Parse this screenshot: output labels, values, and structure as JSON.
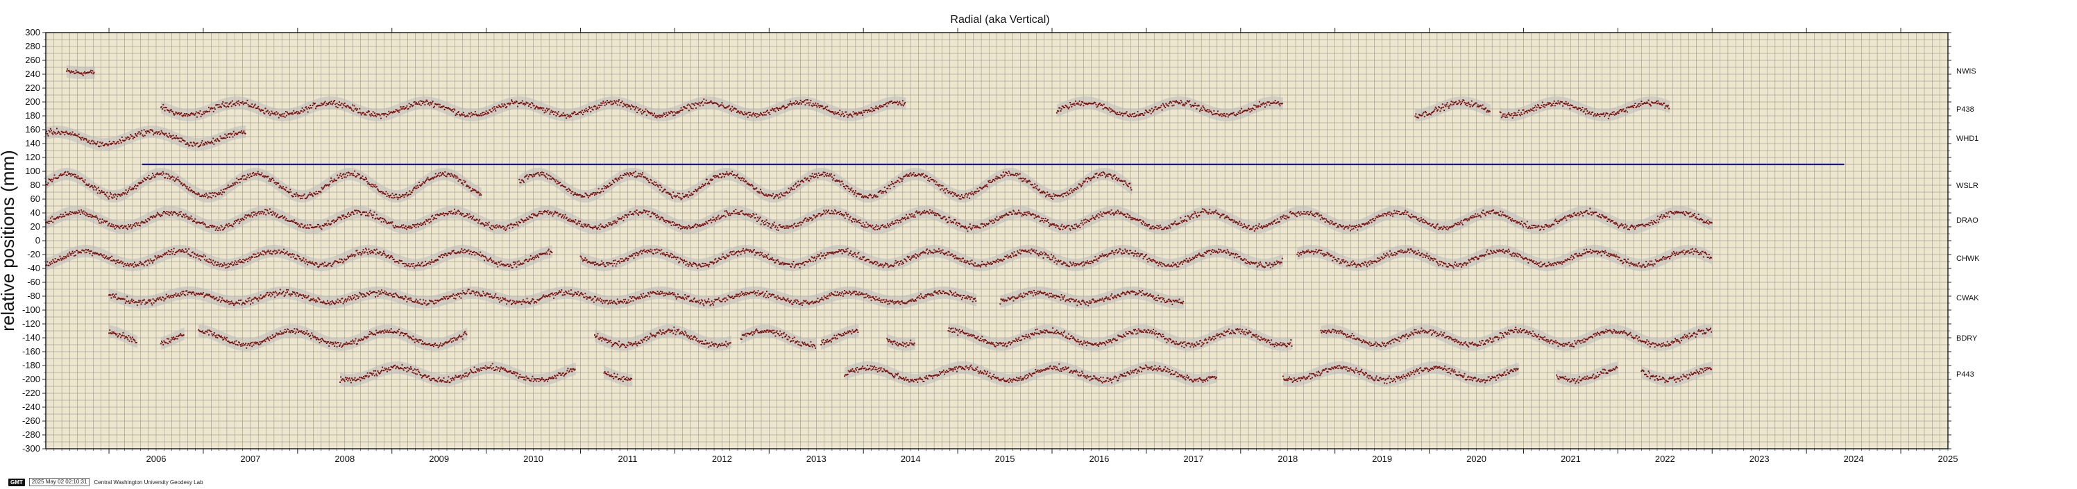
{
  "chart_data": {
    "type": "scatter",
    "title": "Radial (aka Vertical)",
    "ylabel": "relative positions (mm)",
    "xlabel": "",
    "ylim": [
      -300,
      300
    ],
    "xlim": [
      2005.33,
      2025.5
    ],
    "y_ticks": [
      300,
      280,
      260,
      240,
      220,
      200,
      180,
      160,
      140,
      120,
      100,
      80,
      60,
      40,
      20,
      0,
      -20,
      -40,
      -60,
      -80,
      -100,
      -120,
      -140,
      -160,
      -180,
      -200,
      -220,
      -240,
      -260,
      -280,
      -300
    ],
    "x_ticks": [
      "2006",
      "2007",
      "2008",
      "2009",
      "2010",
      "2011",
      "2012",
      "2013",
      "2014",
      "2015",
      "2016",
      "2017",
      "2018",
      "2019",
      "2020",
      "2021",
      "2022",
      "2023",
      "2024",
      "2025"
    ],
    "grid": true,
    "background": "#ede6cf",
    "point_color": "#7a0b0b",
    "error_color": "#b9b9b9",
    "reference_line": {
      "y": 110,
      "x": [
        2006.35,
        2024.4
      ],
      "color": "#16198c"
    },
    "series": [
      {
        "name": "NWIS",
        "offset": 245,
        "amp": 3,
        "segments": [
          [
            2005.55,
            2005.85
          ]
        ]
      },
      {
        "name": "P438",
        "offset": 190,
        "amp": 9,
        "segments": [
          [
            2006.55,
            2014.45
          ],
          [
            2016.05,
            2018.45
          ],
          [
            2019.85,
            2020.65
          ],
          [
            2020.75,
            2022.55
          ]
        ]
      },
      {
        "name": "WHD1",
        "offset": 148,
        "amp": 9,
        "segments": [
          [
            2005.33,
            2007.45
          ]
        ]
      },
      {
        "name": "WSLR",
        "offset": 80,
        "amp": 16,
        "segments": [
          [
            2005.33,
            2009.95
          ],
          [
            2010.35,
            2016.85
          ]
        ]
      },
      {
        "name": "DRAO",
        "offset": 30,
        "amp": 11,
        "segments": [
          [
            2005.33,
            2023.0
          ]
        ]
      },
      {
        "name": "CHWK",
        "offset": -25,
        "amp": 10,
        "segments": [
          [
            2005.33,
            2010.7
          ],
          [
            2011.0,
            2018.45
          ],
          [
            2018.6,
            2023.0
          ]
        ]
      },
      {
        "name": "CWAK",
        "offset": -82,
        "amp": 7,
        "segments": [
          [
            2006.0,
            2015.2
          ],
          [
            2015.45,
            2017.4
          ]
        ]
      },
      {
        "name": "BDRY",
        "offset": -140,
        "amp": 10,
        "segments": [
          [
            2006.0,
            2006.3
          ],
          [
            2006.55,
            2006.8
          ],
          [
            2006.95,
            2009.8
          ],
          [
            2011.15,
            2012.6
          ],
          [
            2012.7,
            2013.5
          ],
          [
            2013.55,
            2013.95
          ],
          [
            2014.25,
            2014.55
          ],
          [
            2014.9,
            2018.55
          ],
          [
            2018.85,
            2023.0
          ]
        ]
      },
      {
        "name": "P443",
        "offset": -192,
        "amp": 9,
        "segments": [
          [
            2008.45,
            2010.95
          ],
          [
            2011.25,
            2011.55
          ],
          [
            2013.8,
            2017.75
          ],
          [
            2018.45,
            2020.95
          ],
          [
            2021.35,
            2022.0
          ],
          [
            2022.25,
            2023.0
          ]
        ]
      }
    ]
  },
  "footer": {
    "logo": "GMT",
    "timestamp": "2025 May 02 02:10:31",
    "credit": "Central Washington University Geodesy Lab"
  }
}
